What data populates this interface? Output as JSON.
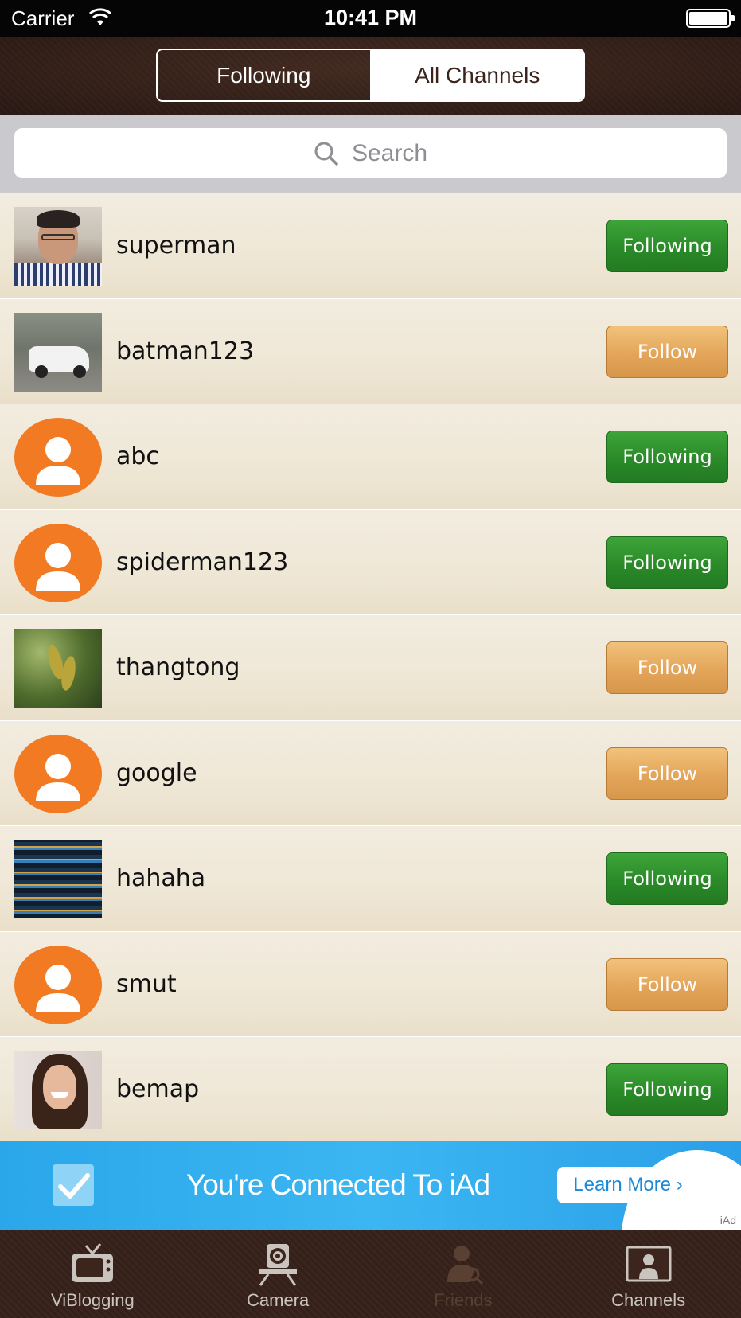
{
  "status_bar": {
    "carrier": "Carrier",
    "time": "10:41 PM"
  },
  "segmented": {
    "following_label": "Following",
    "all_channels_label": "All Channels"
  },
  "search": {
    "placeholder": "Search"
  },
  "channels": [
    {
      "name": "superman",
      "button": "Following",
      "state": "following",
      "avatar": "photo"
    },
    {
      "name": "batman123",
      "button": "Follow",
      "state": "follow",
      "avatar": "photo"
    },
    {
      "name": "abc",
      "button": "Following",
      "state": "following",
      "avatar": "default"
    },
    {
      "name": "spiderman123",
      "button": "Following",
      "state": "following",
      "avatar": "default"
    },
    {
      "name": "thangtong",
      "button": "Follow",
      "state": "follow",
      "avatar": "photo"
    },
    {
      "name": "google",
      "button": "Follow",
      "state": "follow",
      "avatar": "default"
    },
    {
      "name": "hahaha",
      "button": "Following",
      "state": "following",
      "avatar": "photo"
    },
    {
      "name": "smut",
      "button": "Follow",
      "state": "follow",
      "avatar": "default"
    },
    {
      "name": "bemap",
      "button": "Following",
      "state": "following",
      "avatar": "photo"
    }
  ],
  "ad": {
    "text": "You're Connected To iAd",
    "button": "Learn More ›",
    "label": "iAd"
  },
  "tabs": [
    {
      "label": "ViBlogging",
      "icon": "tv-icon"
    },
    {
      "label": "Camera",
      "icon": "camera-icon"
    },
    {
      "label": "Friends",
      "icon": "friends-icon"
    },
    {
      "label": "Channels",
      "icon": "channels-icon"
    }
  ],
  "colors": {
    "following_green": "#2a8a28",
    "follow_orange": "#e3a55a",
    "avatar_orange": "#f27a23",
    "ad_blue": "#2aa7ea"
  }
}
